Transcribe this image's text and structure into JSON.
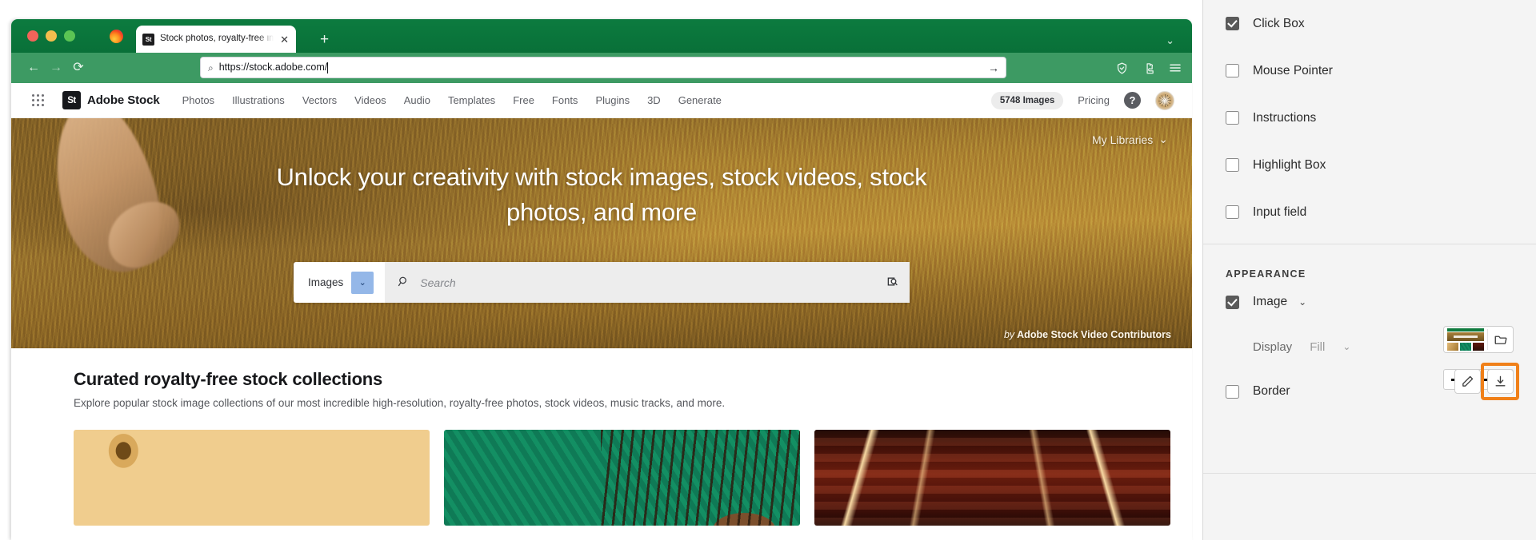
{
  "browser": {
    "tab": {
      "title": "Stock photos, royalty-free imag",
      "favicon_label": "St",
      "close_icon": "✕"
    },
    "new_tab_icon": "+",
    "window_chevron_icon": "⌄",
    "toolbar": {
      "back_icon": "←",
      "forward_icon": "→",
      "reload_icon": "⟳",
      "url_search_icon": "⌕",
      "url": "https://stock.adobe.com/",
      "go_icon": "→",
      "shield_icon": "shield",
      "extensions_icon": "extensions",
      "menu_icon": "≡"
    }
  },
  "site": {
    "app_grid_icon": "apps",
    "brand": {
      "mark": "St",
      "name": "Adobe Stock"
    },
    "nav_links": [
      "Photos",
      "Illustrations",
      "Vectors",
      "Videos",
      "Audio",
      "Templates",
      "Free",
      "Fonts",
      "Plugins",
      "3D",
      "Generate"
    ],
    "image_count_badge": "5748 Images",
    "pricing_label": "Pricing",
    "help_icon_label": "?",
    "hero": {
      "my_libraries": "My Libraries",
      "my_libraries_chevron": "⌄",
      "headline": "Unlock your creativity with stock images, stock videos, stock photos, and more",
      "search": {
        "type_label": "Images",
        "type_chevron": "⌄",
        "search_icon": "⌕",
        "placeholder": "Search",
        "visual_search_icon": "visual-search"
      },
      "credit_prefix": "by",
      "credit": "Adobe Stock Video Contributors"
    },
    "collections": {
      "title": "Curated royalty-free stock collections",
      "subtitle": "Explore popular stock image collections of our most incredible high-resolution, royalty-free photos, stock videos, music tracks, and more.",
      "cards": [
        "golden-tubes-thumbnail",
        "green-striped-braids-thumbnail",
        "red-industrial-corridor-thumbnail"
      ]
    }
  },
  "panel": {
    "options": [
      {
        "label": "Click Box",
        "checked": true
      },
      {
        "label": "Mouse Pointer",
        "checked": false
      },
      {
        "label": "Instructions",
        "checked": false
      },
      {
        "label": "Highlight Box",
        "checked": false
      },
      {
        "label": "Input field",
        "checked": false
      }
    ],
    "appearance": {
      "heading": "APPEARANCE",
      "image": {
        "label": "Image",
        "checked": true,
        "chevron": "⌄"
      },
      "display": {
        "label": "Display",
        "value": "Fill",
        "chevron": "⌄"
      },
      "border": {
        "label": "Border",
        "checked": false
      },
      "folder_icon": "folder",
      "edit_icon": "pencil",
      "download_icon": "download",
      "highlight_color": "#f08019"
    }
  }
}
